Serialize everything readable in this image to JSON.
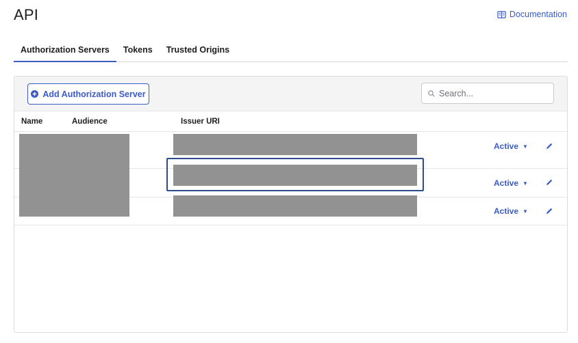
{
  "page": {
    "title": "API"
  },
  "header": {
    "doc_link_label": "Documentation"
  },
  "tabs": [
    {
      "label": "Authorization Servers",
      "active": true
    },
    {
      "label": "Tokens",
      "active": false
    },
    {
      "label": "Trusted Origins",
      "active": false
    }
  ],
  "toolbar": {
    "add_label": "Add Authorization Server",
    "search_placeholder": "Search..."
  },
  "table": {
    "columns": [
      "Name",
      "Audience",
      "Issuer URI"
    ],
    "rows": [
      {
        "status": "Active"
      },
      {
        "status": "Active"
      },
      {
        "status": "Active"
      }
    ]
  },
  "colors": {
    "accent": "#3a5bc7",
    "redaction": "#929292",
    "focus": "#2a4b8d"
  },
  "icons": {
    "doc": "book-icon",
    "add": "plus-circle-icon",
    "search": "search-icon",
    "edit": "pencil-icon",
    "caret": "caret-down-icon"
  }
}
